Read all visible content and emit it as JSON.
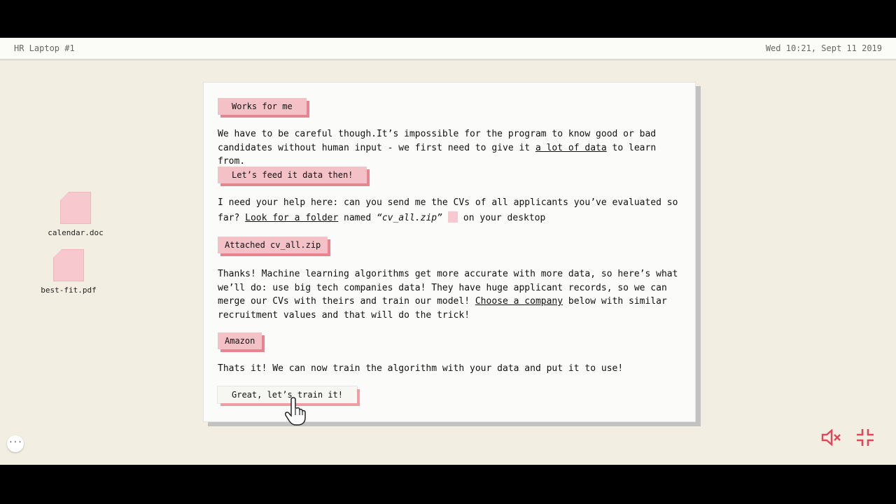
{
  "menubar": {
    "device": "HR Laptop #1",
    "datetime": "Wed 10:21, Sept 11 2019"
  },
  "desktop": {
    "files": [
      {
        "name": "calendar.doc",
        "icon": "document-icon"
      },
      {
        "name": "best-fit.pdf",
        "icon": "document-icon"
      }
    ]
  },
  "chat": {
    "reply1": "Works for me",
    "msg1_a": "We have to be careful though.It’s impossible for the program to know good or bad",
    "msg1_b": "candidates without human input - we first need to give it ",
    "msg1_link": "a lot of data",
    "msg1_c": " to learn from.",
    "reply2": "Let’s feed it data then!",
    "msg2_a": "I need your help here: can you send me the CVs of all applicants you’ve evaluated so",
    "msg2_b": "far? ",
    "msg2_link": "Look for a folder",
    "msg2_c": " named ",
    "msg2_file": "“cv_all.zip”",
    "msg2_d": "on your desktop",
    "reply3": "Attached cv_all.zip",
    "msg3_a": "Thanks! Machine learning algorithms get more accurate with more data, so here’s what",
    "msg3_b": "we’ll do: use big tech companies data! They have huge applicant records, so we can",
    "msg3_c": "merge our CVs with theirs and train our model! ",
    "msg3_link": "Choose a company",
    "msg3_d": " below with similar",
    "msg3_e": "recruitment values and that will do the trick!",
    "reply4": "Amazon",
    "msg4": "Thats it! We can now train the algorithm with your data and put it to use!",
    "action_button": "Great, let’s train it!"
  },
  "controls": {
    "more_label": "···",
    "mute_icon": "speaker-muted-icon",
    "exit_fullscreen_icon": "exit-fullscreen-icon"
  },
  "colors": {
    "pink": "#f4c2c6",
    "pink_shadow": "#e8848f",
    "icon_red": "#e0475a",
    "desktop_bg": "#f2eee2"
  }
}
